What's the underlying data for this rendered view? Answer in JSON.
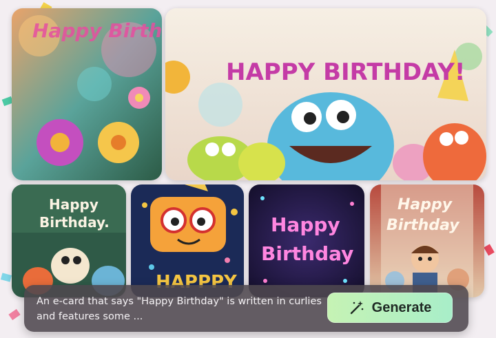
{
  "cards": [
    {
      "label": "Happy Birthday"
    },
    {
      "label": "HAPPY BIRTHDAY!"
    },
    {
      "label_line1": "Happy",
      "label_line2": "Birthday."
    },
    {
      "label": "HAPPPY"
    },
    {
      "label_line1": "Happy",
      "label_line2": "Birthday"
    },
    {
      "label_line1": "Happy",
      "label_line2": "Birthday"
    }
  ],
  "prompt": {
    "text": "An e-card that says \"Happy Birthday\" is written in curlies and features some ..."
  },
  "generate_button": {
    "label": "Generate",
    "icon": "magic-wand-icon"
  },
  "colors": {
    "button_gradient_start": "#c6f3b4",
    "button_gradient_end": "#a8eec9",
    "prompt_bar_bg": "#4e484e"
  }
}
